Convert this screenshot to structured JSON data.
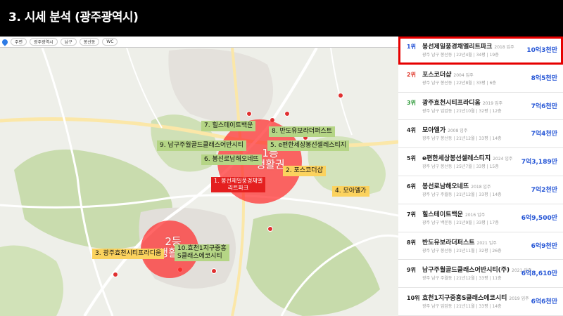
{
  "page": {
    "title": "3. 시세 분석 (광주광역시)"
  },
  "map": {
    "toolbar": [
      {
        "label": "주변"
      },
      {
        "label": "광주광역시"
      },
      {
        "label": "남구"
      },
      {
        "label": "봉선동"
      },
      {
        "label": "WC"
      }
    ],
    "zones": [
      {
        "label": "1등\n생활권"
      },
      {
        "label": "2등\n생활권"
      }
    ],
    "apartment_labels": [
      {
        "text": "1. 봉선제일풍경채엘\n리트파크",
        "style": "red"
      },
      {
        "text": "2. 포스코더샵",
        "style": "yellow"
      },
      {
        "text": "3. 광주효천시티프라디움",
        "style": "yellow"
      },
      {
        "text": "4. 모아엘가",
        "style": "yellow"
      },
      {
        "text": "5. e편한세상봉선셀레스티지",
        "style": "green"
      },
      {
        "text": "6. 봉선로남해오네뜨",
        "style": "green"
      },
      {
        "text": "7. 힐스테이트백운",
        "style": "green"
      },
      {
        "text": "8. 반도유보라더퍼스트",
        "style": "green"
      },
      {
        "text": "9. 남구주월골드클래스어반시티",
        "style": "green"
      },
      {
        "text": "10.효천1지구중흥\nS클래스에코시티",
        "style": "green"
      }
    ]
  },
  "ranking": [
    {
      "rank": "1위",
      "name": "봉선제일풍경채엘리트파크",
      "year": "2018 입주",
      "meta": "광주 남구 봉선동 | 22년4월 | 34평 | 19층",
      "price": "10억3천만",
      "color": "blue"
    },
    {
      "rank": "2위",
      "name": "포스코더샵",
      "year": "2004 입주",
      "meta": "광주 남구 봉선동 | 22년8월 | 33평 | 6층",
      "price": "8억5천만",
      "color": "red"
    },
    {
      "rank": "3위",
      "name": "광주효천시티프라디움",
      "year": "2019 입주",
      "meta": "광주 남구 임암동 | 21년10월 | 32평 | 12층",
      "price": "7억6천만",
      "color": "green"
    },
    {
      "rank": "4위",
      "name": "모아엘가",
      "year": "2008 입주",
      "meta": "광주 남구 봉선동 | 21년12월 | 33평 | 14층",
      "price": "7억4천만",
      "color": "plain"
    },
    {
      "rank": "5위",
      "name": "e편한세상봉선셀레스티지",
      "year": "2024 입주",
      "meta": "광주 남구 봉선동 | 25년7월 | 33평 | 15층",
      "price": "7억3,189만",
      "color": "plain"
    },
    {
      "rank": "6위",
      "name": "봉선로남해오네뜨",
      "year": "2018 입주",
      "meta": "광주 남구 주월동 | 21년12월 | 33평 | 14층",
      "price": "7억2천만",
      "color": "plain"
    },
    {
      "rank": "7위",
      "name": "힐스테이트백운",
      "year": "2016 입주",
      "meta": "광주 남구 백운동 | 21년9월 | 33평 | 17층",
      "price": "6억9,500만",
      "color": "plain"
    },
    {
      "rank": "8위",
      "name": "반도유보라더퍼스트",
      "year": "2021 입주",
      "meta": "광주 남구 봉선동 | 21년11월 | 32평 | 26층",
      "price": "6억9천만",
      "color": "plain"
    },
    {
      "rank": "9위",
      "name": "남구주월골드클래스어반시티(주)",
      "year": "2021 입주",
      "meta": "광주 남구 주월동 | 21년12월 | 33평 | 11층",
      "price": "6억8,610만",
      "color": "plain"
    },
    {
      "rank": "10위",
      "name": "효천1지구중흥S클래스에코시티",
      "year": "2019 입주",
      "meta": "광주 남구 임암동 | 21년11월 | 33평 | 14층",
      "price": "6억6천만",
      "color": "plain"
    }
  ]
}
